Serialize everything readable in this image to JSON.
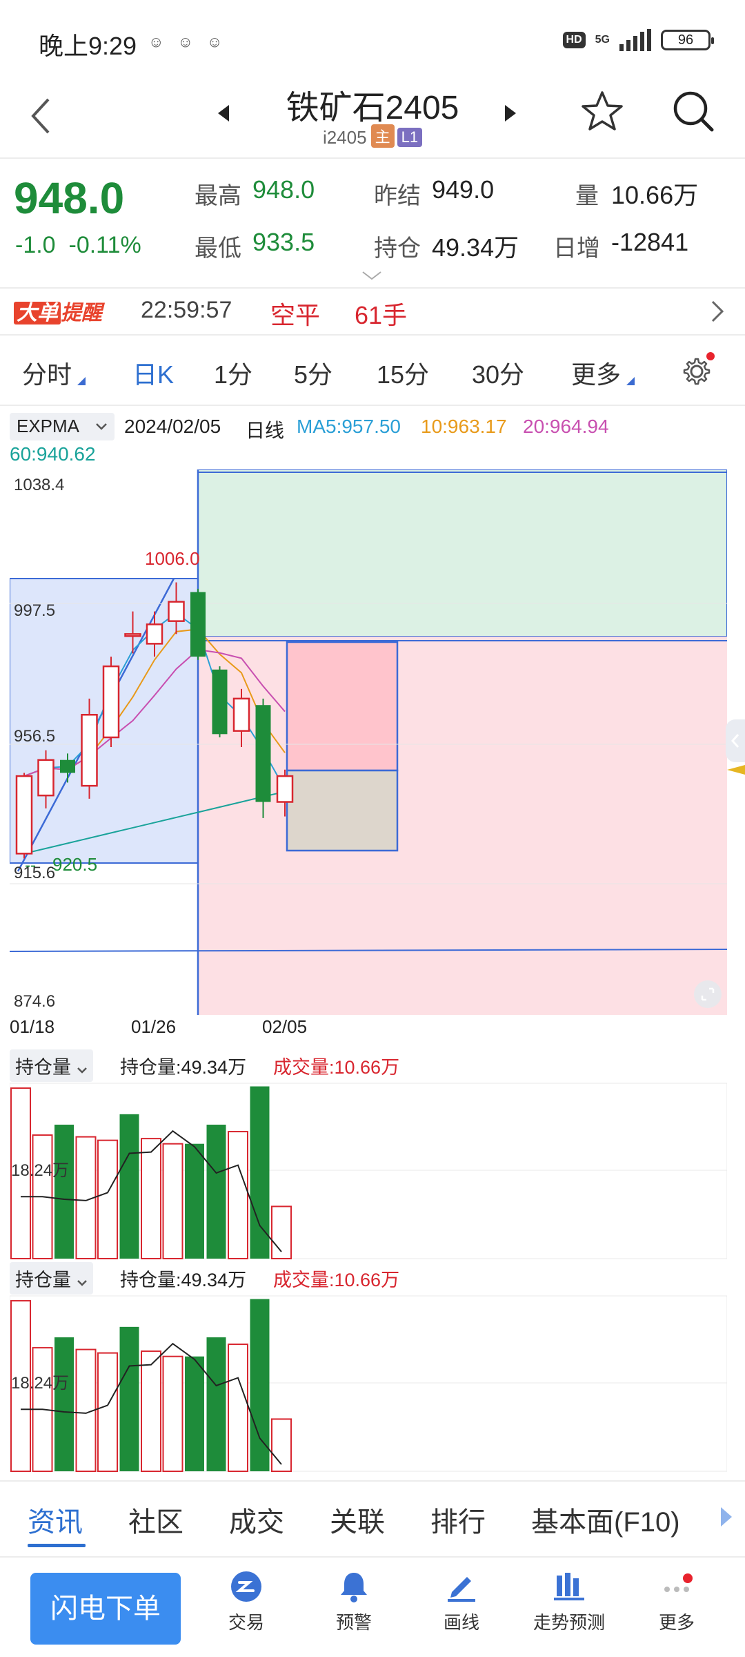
{
  "status_bar": {
    "time": "晚上9:29",
    "network": "5G",
    "battery": "96",
    "hd": "HD"
  },
  "header": {
    "title": "铁矿石2405",
    "code": "i2405",
    "badge_main": "主",
    "badge_level": "L1"
  },
  "quote": {
    "last": "948.0",
    "change": "-1.0",
    "change_pct": "-0.11%",
    "high_label": "最高",
    "high": "948.0",
    "low_label": "最低",
    "low": "933.5",
    "prev_settle_label": "昨结",
    "prev_settle": "949.0",
    "open_interest_label": "持仓",
    "open_interest": "49.34万",
    "volume_label": "量",
    "volume": "10.66万",
    "daily_inc_label": "日增",
    "daily_inc": "-12841"
  },
  "alert": {
    "badge_a": "大单",
    "badge_b": "提醒",
    "time": "22:59:57",
    "type": "空平",
    "qty": "61手"
  },
  "periods": {
    "tabs": [
      "分时",
      "日K",
      "1分",
      "5分",
      "15分",
      "30分",
      "更多"
    ],
    "active": "日K"
  },
  "indicator": {
    "name": "EXPMA",
    "date": "2024/02/05",
    "period": "日线",
    "ma5": "MA5:957.50",
    "ma10": "10:963.17",
    "ma20": "20:964.94",
    "ma60": "60:940.62"
  },
  "chart_data": {
    "type": "candlestick",
    "y_ticks": [
      "1038.4",
      "997.5",
      "956.5",
      "915.6",
      "874.6"
    ],
    "x_ticks": [
      "01/18",
      "01/26",
      "02/05"
    ],
    "high_annotation": "1006.0",
    "low_annotation": "920.5",
    "candles": [
      {
        "o": 922,
        "c": 946,
        "h": 947,
        "l": 920.5,
        "dir": "up"
      },
      {
        "o": 940,
        "c": 951,
        "h": 954,
        "l": 936,
        "dir": "up"
      },
      {
        "o": 951,
        "c": 947,
        "h": 953,
        "l": 944,
        "dir": "down"
      },
      {
        "o": 943,
        "c": 965,
        "h": 970,
        "l": 939,
        "dir": "up"
      },
      {
        "o": 958,
        "c": 980,
        "h": 983,
        "l": 955,
        "dir": "up"
      },
      {
        "o": 990,
        "c": 990,
        "h": 997,
        "l": 984,
        "dir": "flat"
      },
      {
        "o": 987,
        "c": 993,
        "h": 997,
        "l": 983,
        "dir": "up"
      },
      {
        "o": 994,
        "c": 1000,
        "h": 1006,
        "l": 990,
        "dir": "up"
      },
      {
        "o": 1003,
        "c": 983,
        "h": 1004,
        "l": 982,
        "dir": "down"
      },
      {
        "o": 979,
        "c": 959,
        "h": 980,
        "l": 958,
        "dir": "down"
      },
      {
        "o": 960,
        "c": 970,
        "h": 973,
        "l": 955,
        "dir": "up"
      },
      {
        "o": 968,
        "c": 938,
        "h": 970,
        "l": 933,
        "dir": "down"
      },
      {
        "o": 938,
        "c": 946,
        "h": 948,
        "l": 933.5,
        "dir": "up"
      }
    ],
    "ylim": [
      874.6,
      1038.4
    ]
  },
  "volume_panels": [
    {
      "label": "持仓量",
      "oi_text": "持仓量:49.34万",
      "vol_text": "成交量:10.66万",
      "level": "18.24万"
    },
    {
      "label": "持仓量",
      "oi_text": "持仓量:49.34万",
      "vol_text": "成交量:10.66万",
      "level": "18.24万"
    }
  ],
  "volume_data": {
    "bars": [
      {
        "v": 0.98,
        "dir": "up"
      },
      {
        "v": 0.71,
        "dir": "up"
      },
      {
        "v": 0.77,
        "dir": "down"
      },
      {
        "v": 0.7,
        "dir": "up"
      },
      {
        "v": 0.68,
        "dir": "up"
      },
      {
        "v": 0.83,
        "dir": "down"
      },
      {
        "v": 0.69,
        "dir": "up"
      },
      {
        "v": 0.66,
        "dir": "up"
      },
      {
        "v": 0.66,
        "dir": "down"
      },
      {
        "v": 0.77,
        "dir": "down"
      },
      {
        "v": 0.73,
        "dir": "up"
      },
      {
        "v": 0.99,
        "dir": "down"
      },
      {
        "v": 0.3,
        "dir": "up"
      }
    ],
    "oi_line": [
      0.42,
      0.42,
      0.4,
      0.39,
      0.45,
      0.75,
      0.76,
      0.92,
      0.8,
      0.6,
      0.66,
      0.2,
      0.0
    ]
  },
  "info_tabs": [
    "资讯",
    "社区",
    "成交",
    "关联",
    "排行",
    "基本面(F10)"
  ],
  "bottom_nav": {
    "flash_order": "闪电下单",
    "items": [
      "交易",
      "预警",
      "画线",
      "走势预测",
      "更多"
    ]
  },
  "colors": {
    "up": "#d8262f",
    "down": "#1e8c3a",
    "accent": "#2d6fd0"
  }
}
